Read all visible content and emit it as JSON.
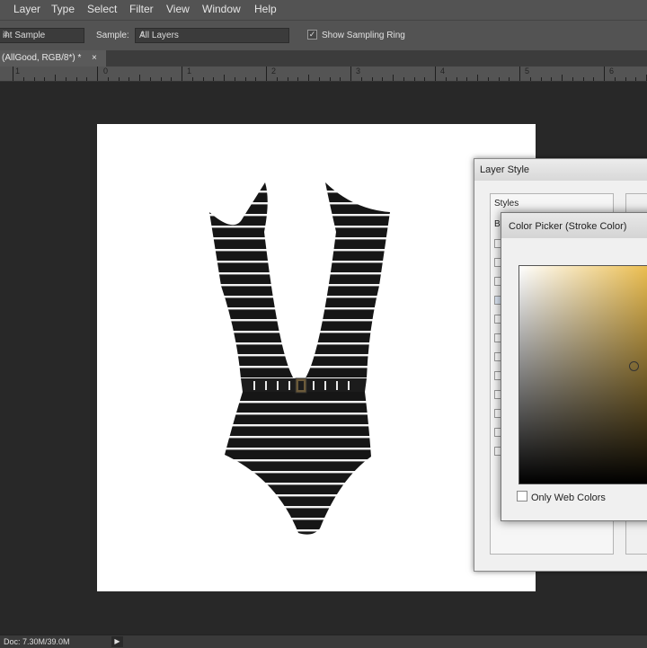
{
  "menu": [
    "Layer",
    "Type",
    "Select",
    "Filter",
    "View",
    "Window",
    "Help"
  ],
  "options": {
    "sample_size_value": "int Sample",
    "sample_label": "Sample:",
    "sample_value": "All Layers",
    "show_ring_label": "Show Sampling Ring",
    "show_ring_checked": true
  },
  "document_tab": {
    "title": "(AllGood, RGB/8*) *",
    "close": "×"
  },
  "ruler": {
    "labels": [
      "1",
      "0",
      "1",
      "2",
      "3",
      "4",
      "5",
      "6"
    ]
  },
  "status": {
    "doc": "Doc: 7.30M/39.0M",
    "arrow": "▶"
  },
  "layer_style": {
    "title": "Layer Style",
    "styles_header": "Styles",
    "first_item_fragment": "Bl",
    "stroke_checked": true
  },
  "color_picker": {
    "title": "Color Picker (Stroke Color)",
    "only_web_colors": "Only Web Colors",
    "accent_color": "#e9b63b"
  }
}
